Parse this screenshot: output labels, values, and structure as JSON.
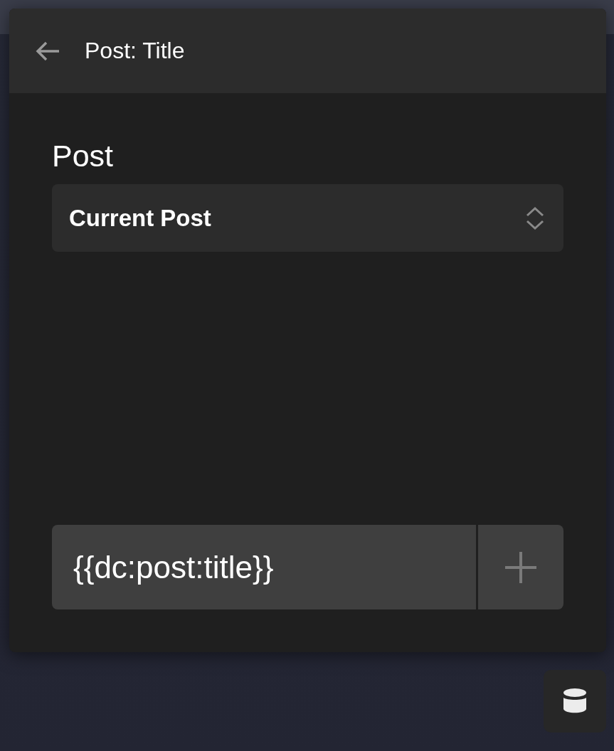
{
  "header": {
    "title": "Post: Title"
  },
  "field": {
    "label": "Post",
    "select_value": "Current Post"
  },
  "token": {
    "value": "{{dc:post:title}}"
  }
}
